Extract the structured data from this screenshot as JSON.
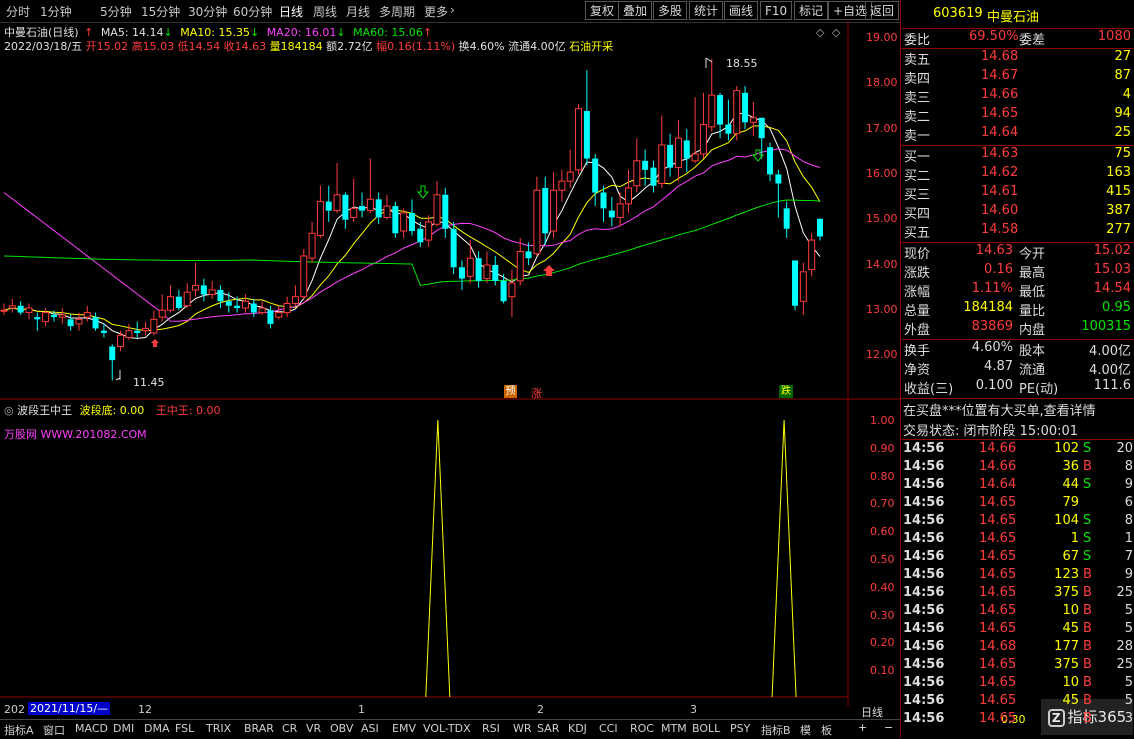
{
  "toolbar": {
    "periods": [
      "分时",
      "1分钟",
      "5分钟",
      "15分钟",
      "30分钟",
      "60分钟",
      "日线",
      "周线",
      "月线",
      "多周期",
      "更多"
    ],
    "active_period": "日线",
    "buttons": [
      "复权",
      "叠加",
      "多股",
      "统计",
      "画线",
      "F10",
      "标记",
      "+自选",
      "返回"
    ]
  },
  "info": {
    "name": "中曼石油(日线)",
    "ma5": "MA5: 14.14",
    "ma10": "MA10: 15.35",
    "ma20": "MA20: 16.01",
    "ma60": "MA60: 15.06",
    "date": "2022/03/18/五",
    "open": "开15.02",
    "high": "高15.03",
    "low": "低14.54",
    "close": "收14.63",
    "vol": "量184184",
    "amount": "额2.72亿",
    "amp": "幅0.16(1.11%)",
    "turnover": "换4.60%",
    "float": "流通4.00亿",
    "concept": "石油开采"
  },
  "price_axis": [
    "19.00",
    "18.00",
    "17.00",
    "16.00",
    "15.00",
    "14.00",
    "13.00",
    "12.00"
  ],
  "chart_labels": {
    "high": "18.55",
    "low": "11.45",
    "yu": "预",
    "zhang": "涨",
    "die": "跌"
  },
  "indicator": {
    "name": "波段王中王",
    "bd_label": "波段底: 0.00",
    "wz_label": "王中王: 0.00",
    "site": "万股网 WWW.201082.COM",
    "axis": [
      "1.00",
      "0.90",
      "0.80",
      "0.70",
      "0.60",
      "0.50",
      "0.40",
      "0.30",
      "0.20",
      "0.10"
    ]
  },
  "time_axis": {
    "start": "202",
    "date": "2021/11/15/—",
    "m12": "12",
    "m1": "1",
    "m2": "2",
    "m3": "3"
  },
  "chart_data": {
    "type": "candlestick",
    "x": [
      "2021-11-15 → 2022-03-18 (approx. 80 trading days)"
    ],
    "candles": [
      [
        13.0,
        13.0,
        13.15,
        12.9
      ],
      [
        13.05,
        13.1,
        13.25,
        12.95
      ],
      [
        13.1,
        12.95,
        13.2,
        12.9
      ],
      [
        12.95,
        13.05,
        13.15,
        12.8
      ],
      [
        12.85,
        12.8,
        12.95,
        12.55
      ],
      [
        12.75,
        12.95,
        13.05,
        12.65
      ],
      [
        12.9,
        12.85,
        13.0,
        12.75
      ],
      [
        12.85,
        12.9,
        13.05,
        12.7
      ],
      [
        12.8,
        12.65,
        12.9,
        12.55
      ],
      [
        12.7,
        12.8,
        12.95,
        12.55
      ],
      [
        12.85,
        12.95,
        13.1,
        12.75
      ],
      [
        12.85,
        12.6,
        12.95,
        12.55
      ],
      [
        12.55,
        12.5,
        12.7,
        12.4
      ],
      [
        12.2,
        11.9,
        12.25,
        11.45
      ],
      [
        12.2,
        12.45,
        12.55,
        12.1
      ],
      [
        12.4,
        12.55,
        12.7,
        12.35
      ],
      [
        12.55,
        12.5,
        12.75,
        12.4
      ],
      [
        12.55,
        12.6,
        12.75,
        12.45
      ],
      [
        12.5,
        12.8,
        13.0,
        12.45
      ],
      [
        12.85,
        13.0,
        13.35,
        12.75
      ],
      [
        13.0,
        13.3,
        13.55,
        12.95
      ],
      [
        13.3,
        13.05,
        13.45,
        13.0
      ],
      [
        13.1,
        13.4,
        13.6,
        13.05
      ],
      [
        13.45,
        13.55,
        14.05,
        13.3
      ],
      [
        13.55,
        13.35,
        13.7,
        13.2
      ],
      [
        13.35,
        13.45,
        13.65,
        13.25
      ],
      [
        13.45,
        13.2,
        13.55,
        13.05
      ],
      [
        13.2,
        13.1,
        13.4,
        12.95
      ],
      [
        13.1,
        13.05,
        13.3,
        12.95
      ],
      [
        13.05,
        13.2,
        13.35,
        12.95
      ],
      [
        13.15,
        12.95,
        13.25,
        12.85
      ],
      [
        12.95,
        13.05,
        13.2,
        12.9
      ],
      [
        13.0,
        12.7,
        13.1,
        12.6
      ],
      [
        12.85,
        12.95,
        13.1,
        12.8
      ],
      [
        12.95,
        13.15,
        13.3,
        12.85
      ],
      [
        13.15,
        13.3,
        13.55,
        13.1
      ],
      [
        13.3,
        14.2,
        14.35,
        13.25
      ],
      [
        14.15,
        14.7,
        14.95,
        14.05
      ],
      [
        14.65,
        15.4,
        15.75,
        14.6
      ],
      [
        15.4,
        15.2,
        15.75,
        14.95
      ],
      [
        15.2,
        15.55,
        16.25,
        15.15
      ],
      [
        15.55,
        15.0,
        15.6,
        14.8
      ],
      [
        15.05,
        15.25,
        15.9,
        14.95
      ],
      [
        15.3,
        15.2,
        15.6,
        15.05
      ],
      [
        15.2,
        15.45,
        16.35,
        15.15
      ],
      [
        15.45,
        15.05,
        15.6,
        14.9
      ],
      [
        15.05,
        15.3,
        15.55,
        15.0
      ],
      [
        15.3,
        14.7,
        15.4,
        14.6
      ],
      [
        14.75,
        15.15,
        15.25,
        14.6
      ],
      [
        15.15,
        14.75,
        15.45,
        14.65
      ],
      [
        14.8,
        14.5,
        14.95,
        14.4
      ],
      [
        14.55,
        14.95,
        15.1,
        14.4
      ],
      [
        14.9,
        15.55,
        15.85,
        14.85
      ],
      [
        15.55,
        14.8,
        15.7,
        14.6
      ],
      [
        14.8,
        13.95,
        14.95,
        13.8
      ],
      [
        13.95,
        13.7,
        14.1,
        13.45
      ],
      [
        13.75,
        14.15,
        14.55,
        13.6
      ],
      [
        14.15,
        13.65,
        14.3,
        13.5
      ],
      [
        13.7,
        14.0,
        14.3,
        13.6
      ],
      [
        14.0,
        13.65,
        14.2,
        13.55
      ],
      [
        13.65,
        13.2,
        13.8,
        13.15
      ],
      [
        13.3,
        13.6,
        13.9,
        12.85
      ],
      [
        13.65,
        14.3,
        14.6,
        13.55
      ],
      [
        14.3,
        14.15,
        14.5,
        14.0
      ],
      [
        14.25,
        15.65,
        15.95,
        14.2
      ],
      [
        15.7,
        14.7,
        15.95,
        14.45
      ],
      [
        14.75,
        15.65,
        16.05,
        14.6
      ],
      [
        15.65,
        15.85,
        16.1,
        15.4
      ],
      [
        15.85,
        16.05,
        16.55,
        15.7
      ],
      [
        16.1,
        17.45,
        17.55,
        16.0
      ],
      [
        17.4,
        16.35,
        18.3,
        16.2
      ],
      [
        16.35,
        15.6,
        16.45,
        15.3
      ],
      [
        15.6,
        15.25,
        15.75,
        14.95
      ],
      [
        15.2,
        15.05,
        15.5,
        14.85
      ],
      [
        15.05,
        15.35,
        15.6,
        14.85
      ],
      [
        15.35,
        15.7,
        16.1,
        15.15
      ],
      [
        15.75,
        16.3,
        16.8,
        15.6
      ],
      [
        16.3,
        16.1,
        16.55,
        15.75
      ],
      [
        16.15,
        15.75,
        16.3,
        15.6
      ],
      [
        15.8,
        16.65,
        17.3,
        15.7
      ],
      [
        16.65,
        16.15,
        16.9,
        15.95
      ],
      [
        16.15,
        16.8,
        17.2,
        15.85
      ],
      [
        16.75,
        16.35,
        17.0,
        16.05
      ],
      [
        16.3,
        16.45,
        17.7,
        16.25
      ],
      [
        16.45,
        17.1,
        17.8,
        16.35
      ],
      [
        17.05,
        17.75,
        18.55,
        16.95
      ],
      [
        17.75,
        17.1,
        17.8,
        16.8
      ],
      [
        17.1,
        16.9,
        17.65,
        16.75
      ],
      [
        16.9,
        17.85,
        17.95,
        16.75
      ],
      [
        17.8,
        17.15,
        17.95,
        17.0
      ],
      [
        17.15,
        17.25,
        17.6,
        16.85
      ],
      [
        17.25,
        16.8,
        17.2,
        16.35
      ],
      [
        16.6,
        16.0,
        16.7,
        15.85
      ],
      [
        16.0,
        15.8,
        16.1,
        15.05
      ],
      [
        15.25,
        14.8,
        15.4,
        14.6
      ],
      [
        14.1,
        13.1,
        14.1,
        13.0
      ],
      [
        13.2,
        13.85,
        14.05,
        12.9
      ],
      [
        13.9,
        14.55,
        14.7,
        13.75
      ],
      [
        15.02,
        14.63,
        15.03,
        14.54
      ]
    ],
    "ma_legend": [
      "MA5",
      "MA10",
      "MA20",
      "MA60"
    ],
    "indicator_series": {
      "name": "波段王中王",
      "spikes_at_fraction": [
        0.545,
        0.98
      ],
      "spike_value": 1.0
    }
  },
  "panel": {
    "code": "603619",
    "name": "中曼石油",
    "weibi_label": "委比",
    "weibi": "69.50%",
    "weicha_label": "委差",
    "weicha": "1080",
    "asks": [
      {
        "label": "卖五",
        "price": "14.68",
        "vol": "27"
      },
      {
        "label": "卖四",
        "price": "14.67",
        "vol": "87"
      },
      {
        "label": "卖三",
        "price": "14.66",
        "vol": "4"
      },
      {
        "label": "卖二",
        "price": "14.65",
        "vol": "94"
      },
      {
        "label": "卖一",
        "price": "14.64",
        "vol": "25"
      }
    ],
    "bids": [
      {
        "label": "买一",
        "price": "14.63",
        "vol": "75"
      },
      {
        "label": "买二",
        "price": "14.62",
        "vol": "163"
      },
      {
        "label": "买三",
        "price": "14.61",
        "vol": "415"
      },
      {
        "label": "买四",
        "price": "14.60",
        "vol": "387"
      },
      {
        "label": "买五",
        "price": "14.58",
        "vol": "277"
      }
    ],
    "stats": [
      {
        "l1": "现价",
        "v1": "14.63",
        "l2": "今开",
        "v2": "15.02",
        "c1": "red",
        "c2": "red"
      },
      {
        "l1": "涨跌",
        "v1": "0.16",
        "l2": "最高",
        "v2": "15.03",
        "c1": "red",
        "c2": "red"
      },
      {
        "l1": "涨幅",
        "v1": "1.11%",
        "l2": "最低",
        "v2": "14.54",
        "c1": "red",
        "c2": "red"
      },
      {
        "l1": "总量",
        "v1": "184184",
        "l2": "量比",
        "v2": "0.95",
        "c1": "yel",
        "c2": "grn"
      },
      {
        "l1": "外盘",
        "v1": "83869",
        "l2": "内盘",
        "v2": "100315",
        "c1": "red",
        "c2": "grn"
      }
    ],
    "stats2": [
      {
        "l1": "换手",
        "v1": "4.60%",
        "l2": "股本",
        "v2": "4.00亿"
      },
      {
        "l1": "净资",
        "v1": "4.87",
        "l2": "流通",
        "v2": "4.00亿"
      },
      {
        "l1": "收益(三)",
        "v1": "0.100",
        "l2": "PE(动)",
        "v2": "111.6"
      }
    ],
    "notice": "在买盘***位置有大买单,查看详情",
    "trade_status": "交易状态: 闭市阶段 15:00:01",
    "ticks": [
      {
        "t": "14:56",
        "p": "14.66",
        "v": "102",
        "s": "S",
        "n": "20"
      },
      {
        "t": "14:56",
        "p": "14.66",
        "v": "36",
        "s": "B",
        "n": "8"
      },
      {
        "t": "14:56",
        "p": "14.64",
        "v": "44",
        "s": "S",
        "n": "9"
      },
      {
        "t": "14:56",
        "p": "14.65",
        "v": "79",
        "s": "",
        "n": "6"
      },
      {
        "t": "14:56",
        "p": "14.65",
        "v": "104",
        "s": "S",
        "n": "8"
      },
      {
        "t": "14:56",
        "p": "14.65",
        "v": "1",
        "s": "S",
        "n": "1"
      },
      {
        "t": "14:56",
        "p": "14.65",
        "v": "67",
        "s": "S",
        "n": "7"
      },
      {
        "t": "14:56",
        "p": "14.65",
        "v": "123",
        "s": "B",
        "n": "9"
      },
      {
        "t": "14:56",
        "p": "14.65",
        "v": "375",
        "s": "B",
        "n": "25"
      },
      {
        "t": "14:56",
        "p": "14.65",
        "v": "10",
        "s": "B",
        "n": "5"
      },
      {
        "t": "14:56",
        "p": "14.65",
        "v": "45",
        "s": "B",
        "n": "5"
      },
      {
        "t": "14:56",
        "p": "14.68",
        "v": "177",
        "s": "B",
        "n": "28"
      },
      {
        "t": "14:56",
        "p": "14.65",
        "v": "375",
        "s": "B",
        "n": "25"
      },
      {
        "t": "14:56",
        "p": "14.65",
        "v": "10",
        "s": "B",
        "n": "5"
      },
      {
        "t": "14:56",
        "p": "14.65",
        "v": "45",
        "s": "B",
        "n": "5"
      },
      {
        "t": "14:56",
        "p": "14.65",
        "v": "",
        "s": "B",
        "n": "3"
      }
    ]
  },
  "bottom_tabs": [
    "指标A",
    "窗口",
    "MACD",
    "DMI",
    "DMA",
    "FSL",
    "TRIX",
    "BRAR",
    "CR",
    "VR",
    "OBV",
    "ASI",
    "EMV",
    "VOL-TDX",
    "RSI",
    "WR",
    "SAR",
    "KDJ",
    "CCI",
    "ROC",
    "MTM",
    "BOLL",
    "PSY",
    "指标B",
    "模",
    "板"
  ],
  "bottom_right": {
    "plus": "+",
    "minus": "−",
    "line": "日线",
    "axis_val": "0.30",
    "watermark": "指标365"
  }
}
